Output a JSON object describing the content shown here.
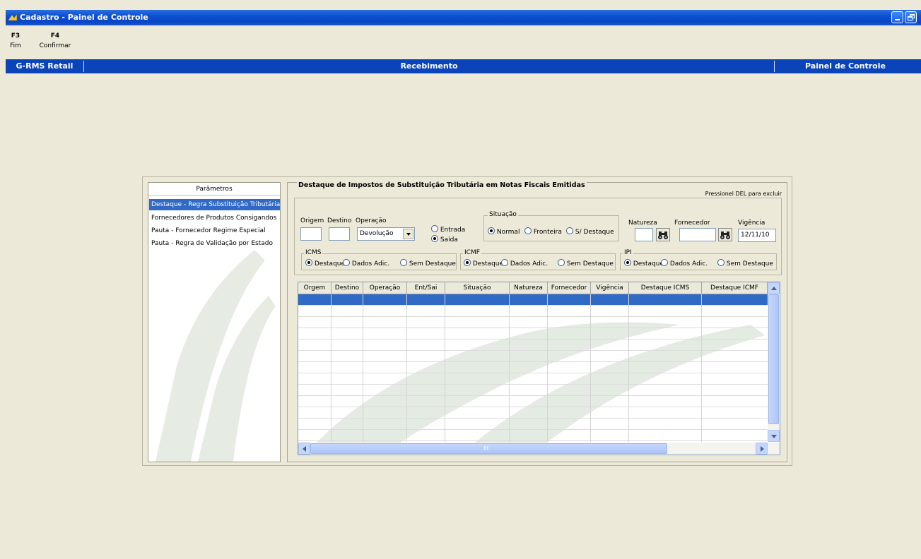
{
  "window": {
    "title": "Cadastro - Painel de Controle",
    "colors": {
      "titlebar": "#0b4fd1",
      "header": "#0a44b8",
      "selection": "#316ac5",
      "background": "#ece9d8"
    }
  },
  "function_keys": [
    {
      "key": "F3",
      "label": "Fim"
    },
    {
      "key": "F4",
      "label": "Confirmar"
    }
  ],
  "header": {
    "left": "G-RMS Retail",
    "center": "Recebimento",
    "right": "Painel de Controle"
  },
  "parameters": {
    "title": "Parâmetros",
    "items": [
      "Destaque - Regra Substituição Tributária",
      "Fornecedores de Produtos Consigandos",
      "Pauta - Fornecedor Regime Especial",
      "Pauta - Regra de Validação por Estado"
    ],
    "selected_index": 0
  },
  "form": {
    "title": "Destaque de Impostos de Substituição Tributária em Notas Fiscais Emitidas",
    "hint": "Pressionel DEL para excluir",
    "origem_label": "Origem",
    "origem_value": "",
    "destino_label": "Destino",
    "destino_value": "",
    "operacao_label": "Operação",
    "operacao_value": "Devolução",
    "entrada_label": "Entrada",
    "saida_label": "Saída",
    "direction_selected": "Saída",
    "situacao": {
      "title": "Situação",
      "options": [
        "Normal",
        "Fronteira",
        "S/ Destaque"
      ],
      "selected": "Normal"
    },
    "natureza_label": "Natureza",
    "natureza_value": "",
    "fornecedor_label": "Fornecedor",
    "fornecedor_value": "",
    "vigencia_label": "Vigência",
    "vigencia_value": "12/11/10",
    "icms": {
      "title": "ICMS",
      "options": [
        "Destaque",
        "Dados Adic.",
        "Sem Destaque"
      ],
      "selected": "Destaque"
    },
    "icmf": {
      "title": "ICMF",
      "options": [
        "Destaque",
        "Dados Adic.",
        "Sem Destaque"
      ],
      "selected": "Destaque"
    },
    "ipi": {
      "title": "IPI",
      "options": [
        "Destaque",
        "Dados Adic.",
        "Sem Destaque"
      ],
      "selected": "Destaque"
    },
    "search_icon": "binoculars-icon"
  },
  "grid": {
    "columns": [
      "Orgem",
      "Destino",
      "Operação",
      "Ent/Sai",
      "Situação",
      "Natureza",
      "Fornecedor",
      "Vigência",
      "Destaque ICMS",
      "Destaque ICMF"
    ],
    "rows": [],
    "scroll_thumb_label": "III"
  }
}
